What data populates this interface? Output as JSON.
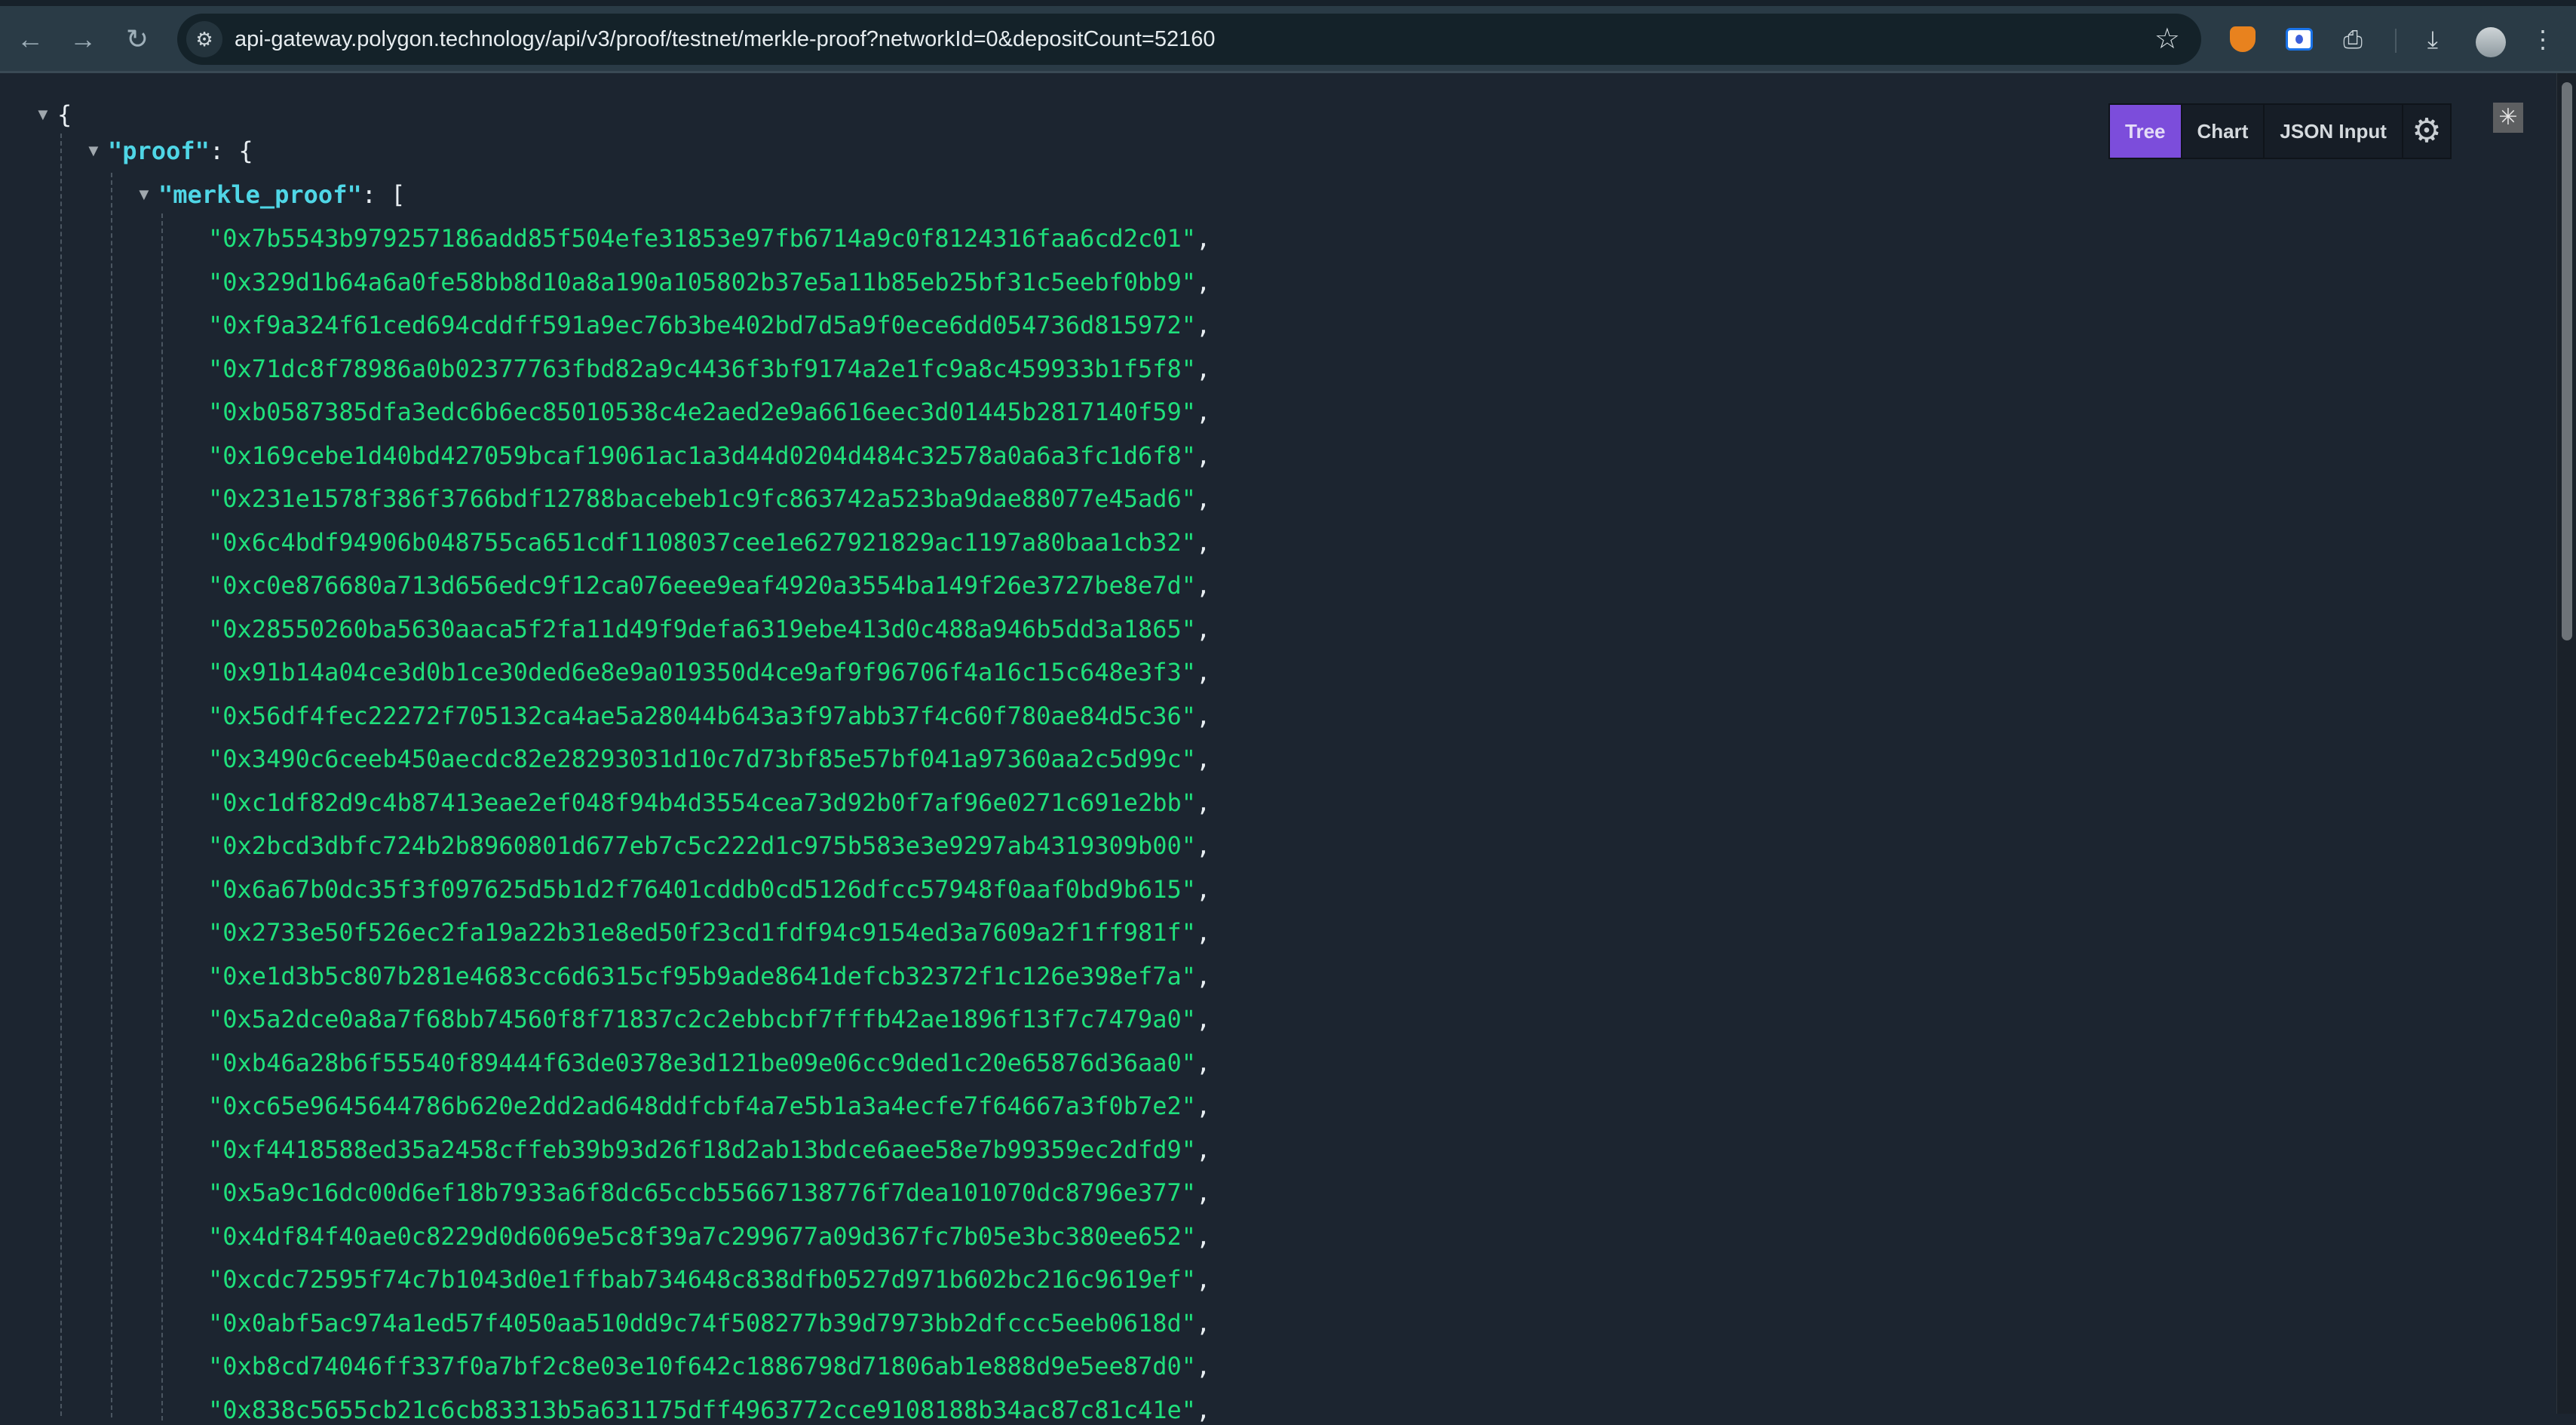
{
  "browser": {
    "url": "api-gateway.polygon.technology/api/v3/proof/testnet/merkle-proof?networkId=0&depositCount=52160",
    "icons": [
      "back-icon",
      "forward-icon",
      "reload-icon",
      "site-info-icon",
      "bookmark-star-icon",
      "metamask-fox-icon",
      "screen-recorder-icon",
      "extensions-puzzle-icon",
      "download-icon",
      "profile-avatar",
      "more-menu-icon"
    ]
  },
  "viewer": {
    "tabs": [
      {
        "label": "Tree",
        "active": true
      },
      {
        "label": "Chart",
        "active": false
      },
      {
        "label": "JSON Input",
        "active": false
      }
    ],
    "accent_color": "#7c4ddb"
  },
  "json": {
    "open_brace": "{",
    "proof_key": "\"proof\"",
    "proof_open": ": {",
    "merkle_key": "\"merkle_proof\"",
    "merkle_open": ": [",
    "merkle_proof": [
      "0x7b5543b979257186add85f504efe31853e97fb6714a9c0f8124316faa6cd2c01",
      "0x329d1b64a6a0fe58bb8d10a8a190a105802b37e5a11b85eb25bf31c5eebf0bb9",
      "0xf9a324f61ced694cddff591a9ec76b3be402bd7d5a9f0ece6dd054736d815972",
      "0x71dc8f78986a0b02377763fbd82a9c4436f3bf9174a2e1fc9a8c459933b1f5f8",
      "0xb0587385dfa3edc6b6ec85010538c4e2aed2e9a6616eec3d01445b2817140f59",
      "0x169cebe1d40bd427059bcaf19061ac1a3d44d0204d484c32578a0a6a3fc1d6f8",
      "0x231e1578f386f3766bdf12788bacebeb1c9fc863742a523ba9dae88077e45ad6",
      "0x6c4bdf94906b048755ca651cdf1108037cee1e627921829ac1197a80baa1cb32",
      "0xc0e876680a713d656edc9f12ca076eee9eaf4920a3554ba149f26e3727be8e7d",
      "0x28550260ba5630aaca5f2fa11d49f9defa6319ebe413d0c488a946b5dd3a1865",
      "0x91b14a04ce3d0b1ce30ded6e8e9a019350d4ce9af9f96706f4a16c15c648e3f3",
      "0x56df4fec22272f705132ca4ae5a28044b643a3f97abb37f4c60f780ae84d5c36",
      "0x3490c6ceeb450aecdc82e28293031d10c7d73bf85e57bf041a97360aa2c5d99c",
      "0xc1df82d9c4b87413eae2ef048f94b4d3554cea73d92b0f7af96e0271c691e2bb",
      "0x2bcd3dbfc724b2b8960801d677eb7c5c222d1c975b583e3e9297ab4319309b00",
      "0x6a67b0dc35f3f097625d5b1d2f76401cddb0cd5126dfcc57948f0aaf0bd9b615",
      "0x2733e50f526ec2fa19a22b31e8ed50f23cd1fdf94c9154ed3a7609a2f1ff981f",
      "0xe1d3b5c807b281e4683cc6d6315cf95b9ade8641defcb32372f1c126e398ef7a",
      "0x5a2dce0a8a7f68bb74560f8f71837c2c2ebbcbf7fffb42ae1896f13f7c7479a0",
      "0xb46a28b6f55540f89444f63de0378e3d121be09e06cc9ded1c20e65876d36aa0",
      "0xc65e9645644786b620e2dd2ad648ddfcbf4a7e5b1a3a4ecfe7f64667a3f0b7e2",
      "0xf4418588ed35a2458cffeb39b93d26f18d2ab13bdce6aee58e7b99359ec2dfd9",
      "0x5a9c16dc00d6ef18b7933a6f8dc65ccb55667138776f7dea101070dc8796e377",
      "0x4df84f40ae0c8229d0d6069e5c8f39a7c299677a09d367fc7b05e3bc380ee652",
      "0xcdc72595f74c7b1043d0e1ffbab734648c838dfb0527d971b602bc216c9619ef",
      "0x0abf5ac974a1ed57f4050aa510dd9c74f508277b39d7973bb2dfccc5eeb0618d",
      "0xb8cd74046ff337f0a7bf2c8e03e10f642c1886798d71806ab1e888d9e5ee87d0",
      "0x838c5655cb21c6cb83313b5a631175dff4963772cce9108188b34ac87c81c41e"
    ]
  }
}
